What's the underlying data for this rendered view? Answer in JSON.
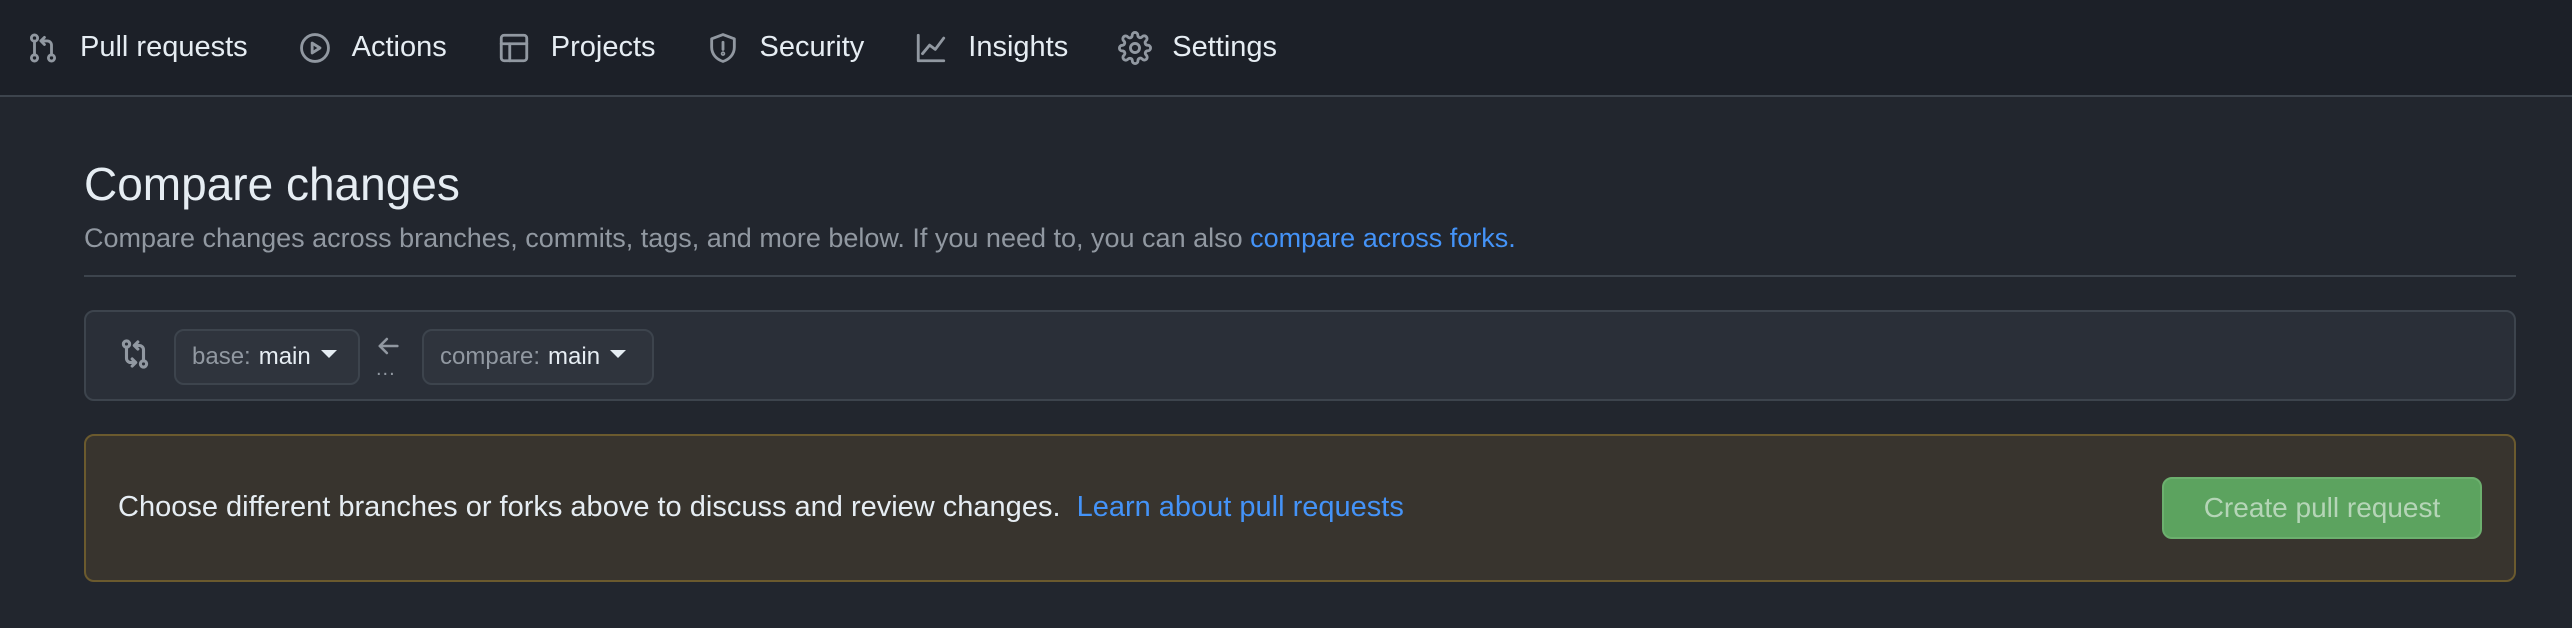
{
  "nav": {
    "items": [
      {
        "label": "Pull requests",
        "icon": "git-pull-request-icon"
      },
      {
        "label": "Actions",
        "icon": "play-icon"
      },
      {
        "label": "Projects",
        "icon": "table-icon"
      },
      {
        "label": "Security",
        "icon": "shield-icon"
      },
      {
        "label": "Insights",
        "icon": "graph-icon"
      },
      {
        "label": "Settings",
        "icon": "gear-icon"
      }
    ]
  },
  "compare": {
    "title": "Compare changes",
    "subtitle": "Compare changes across branches, commits, tags, and more below. If you need to, you can also",
    "subtitle_link": "compare across forks.",
    "base_label": "base:",
    "base_value": "main",
    "compare_label": "compare:",
    "compare_value": "main",
    "dots": "..."
  },
  "notice": {
    "text": "Choose different branches or forks above to discuss and review changes.",
    "link": "Learn about pull requests",
    "button": "Create pull request"
  },
  "colors": {
    "background": "#22262e",
    "accent_link": "#4493f8",
    "create_button": "#5ca35f",
    "notice_background": "#38342e"
  }
}
